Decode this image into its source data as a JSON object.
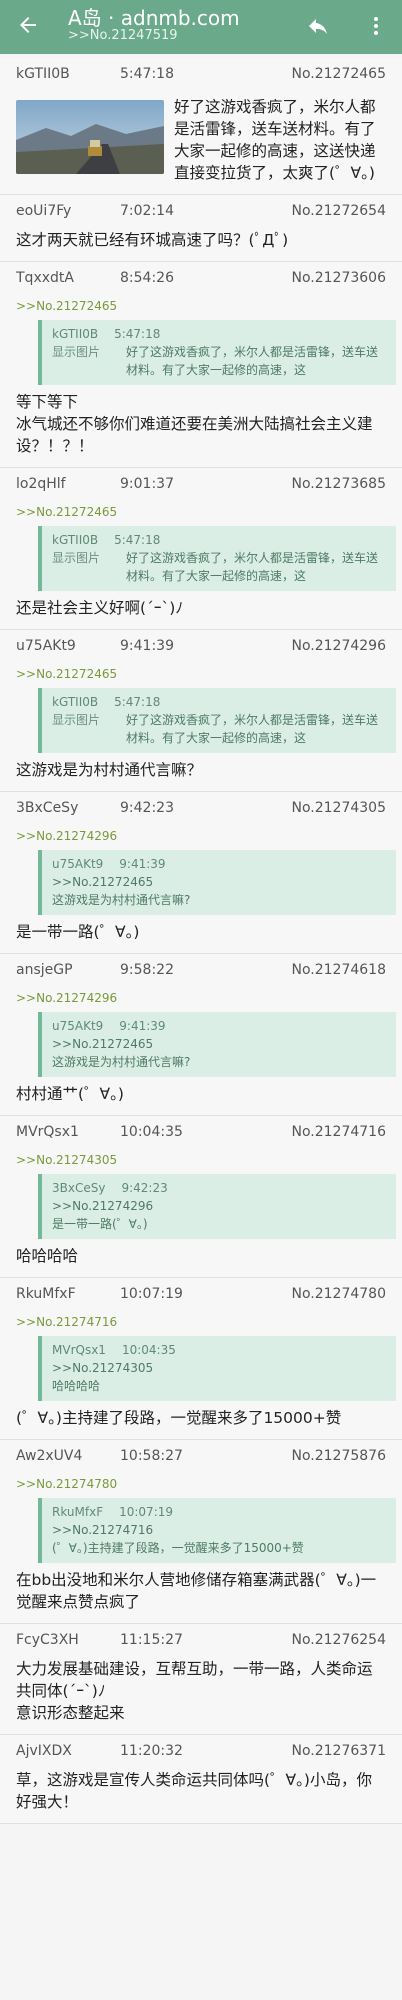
{
  "appbar": {
    "title": "A岛 · adnmb.com",
    "subtitle": ">>No.21247519",
    "back_icon": "arrow-left-icon",
    "reply_icon": "reply-icon",
    "more_icon": "more-vert-icon",
    "color": "#6aa98a"
  },
  "posts": [
    {
      "uid": "kGTII0B",
      "time": "5:47:18",
      "no": "No.21272465",
      "body": "好了这游戏香疯了，米尔人都是活雷锋，送车送材料。有了大家一起修的高速，这送快递直接变拉货了，太爽了(゜∀。)"
    },
    {
      "uid": "eoUi7Fy",
      "time": "7:02:14",
      "no": "No.21272654",
      "body": "这才两天就已经有环城高速了吗？(ﾟДﾟ)"
    },
    {
      "uid": "TqxxdtA",
      "time": "8:54:26",
      "no": "No.21273606",
      "ref": ">>No.21272465",
      "quote": {
        "uid": "kGTII0B",
        "time": "5:47:18",
        "show": "显示图片",
        "text": "好了这游戏香疯了，米尔人都是活雷锋，送车送材料。有了大家一起修的高速，这"
      },
      "body": "等下等下\n冰气城还不够你们难道还要在美洲大陆搞社会主义建设？！？！"
    },
    {
      "uid": "lo2qHlf",
      "time": "9:01:37",
      "no": "No.21273685",
      "ref": ">>No.21272465",
      "quote": {
        "uid": "kGTII0B",
        "time": "5:47:18",
        "show": "显示图片",
        "text": "好了这游戏香疯了，米尔人都是活雷锋，送车送材料。有了大家一起修的高速，这"
      },
      "body": "还是社会主义好啊(´ｰ`)ﾉ"
    },
    {
      "uid": "u75AKt9",
      "time": "9:41:39",
      "no": "No.21274296",
      "ref": ">>No.21272465",
      "quote": {
        "uid": "kGTII0B",
        "time": "5:47:18",
        "show": "显示图片",
        "text": "好了这游戏香疯了，米尔人都是活雷锋，送车送材料。有了大家一起修的高速，这"
      },
      "body": "这游戏是为村村通代言嘛？"
    },
    {
      "uid": "3BxCeSy",
      "time": "9:42:23",
      "no": "No.21274305",
      "ref": ">>No.21274296",
      "quote": {
        "uid": "u75AKt9",
        "time": "9:41:39",
        "text": ">>No.21272465\n这游戏是为村村通代言嘛?"
      },
      "body": "是一带一路(゜∀。)"
    },
    {
      "uid": "ansjeGP",
      "time": "9:58:22",
      "no": "No.21274618",
      "ref": ">>No.21274296",
      "quote": {
        "uid": "u75AKt9",
        "time": "9:41:39",
        "text": ">>No.21272465\n这游戏是为村村通代言嘛?"
      },
      "body": "村村通艹(゜∀。)"
    },
    {
      "uid": "MVrQsx1",
      "time": "10:04:35",
      "no": "No.21274716",
      "ref": ">>No.21274305",
      "quote": {
        "uid": "3BxCeSy",
        "time": "9:42:23",
        "text": ">>No.21274296\n是一带一路(゜∀。)"
      },
      "body": "哈哈哈哈"
    },
    {
      "uid": "RkuMfxF",
      "time": "10:07:19",
      "no": "No.21274780",
      "ref": ">>No.21274716",
      "quote": {
        "uid": "MVrQsx1",
        "time": "10:04:35",
        "text": ">>No.21274305\n哈哈哈哈"
      },
      "body": "(゜∀。)主持建了段路，一觉醒来多了15000+赞"
    },
    {
      "uid": "Aw2xUV4",
      "time": "10:58:27",
      "no": "No.21275876",
      "ref": ">>No.21274780",
      "quote": {
        "uid": "RkuMfxF",
        "time": "10:07:19",
        "text": ">>No.21274716\n(゜∀。)主持建了段路，一觉醒来多了15000+赞"
      },
      "body": "在bb出没地和米尔人营地修储存箱塞满武器(゜∀。)一觉醒来点赞点疯了"
    },
    {
      "uid": "FcyC3XH",
      "time": "11:15:27",
      "no": "No.21276254",
      "body": "大力发展基础建设，互帮互助，一带一路，人类命运共同体(´ｰ`)ﾉ\n意识形态整起来"
    },
    {
      "uid": "AjvIXDX",
      "time": "11:20:32",
      "no": "No.21276371",
      "body": "草，这游戏是宣传人类命运共同体吗(゜∀。)小岛，你好强大！"
    }
  ]
}
